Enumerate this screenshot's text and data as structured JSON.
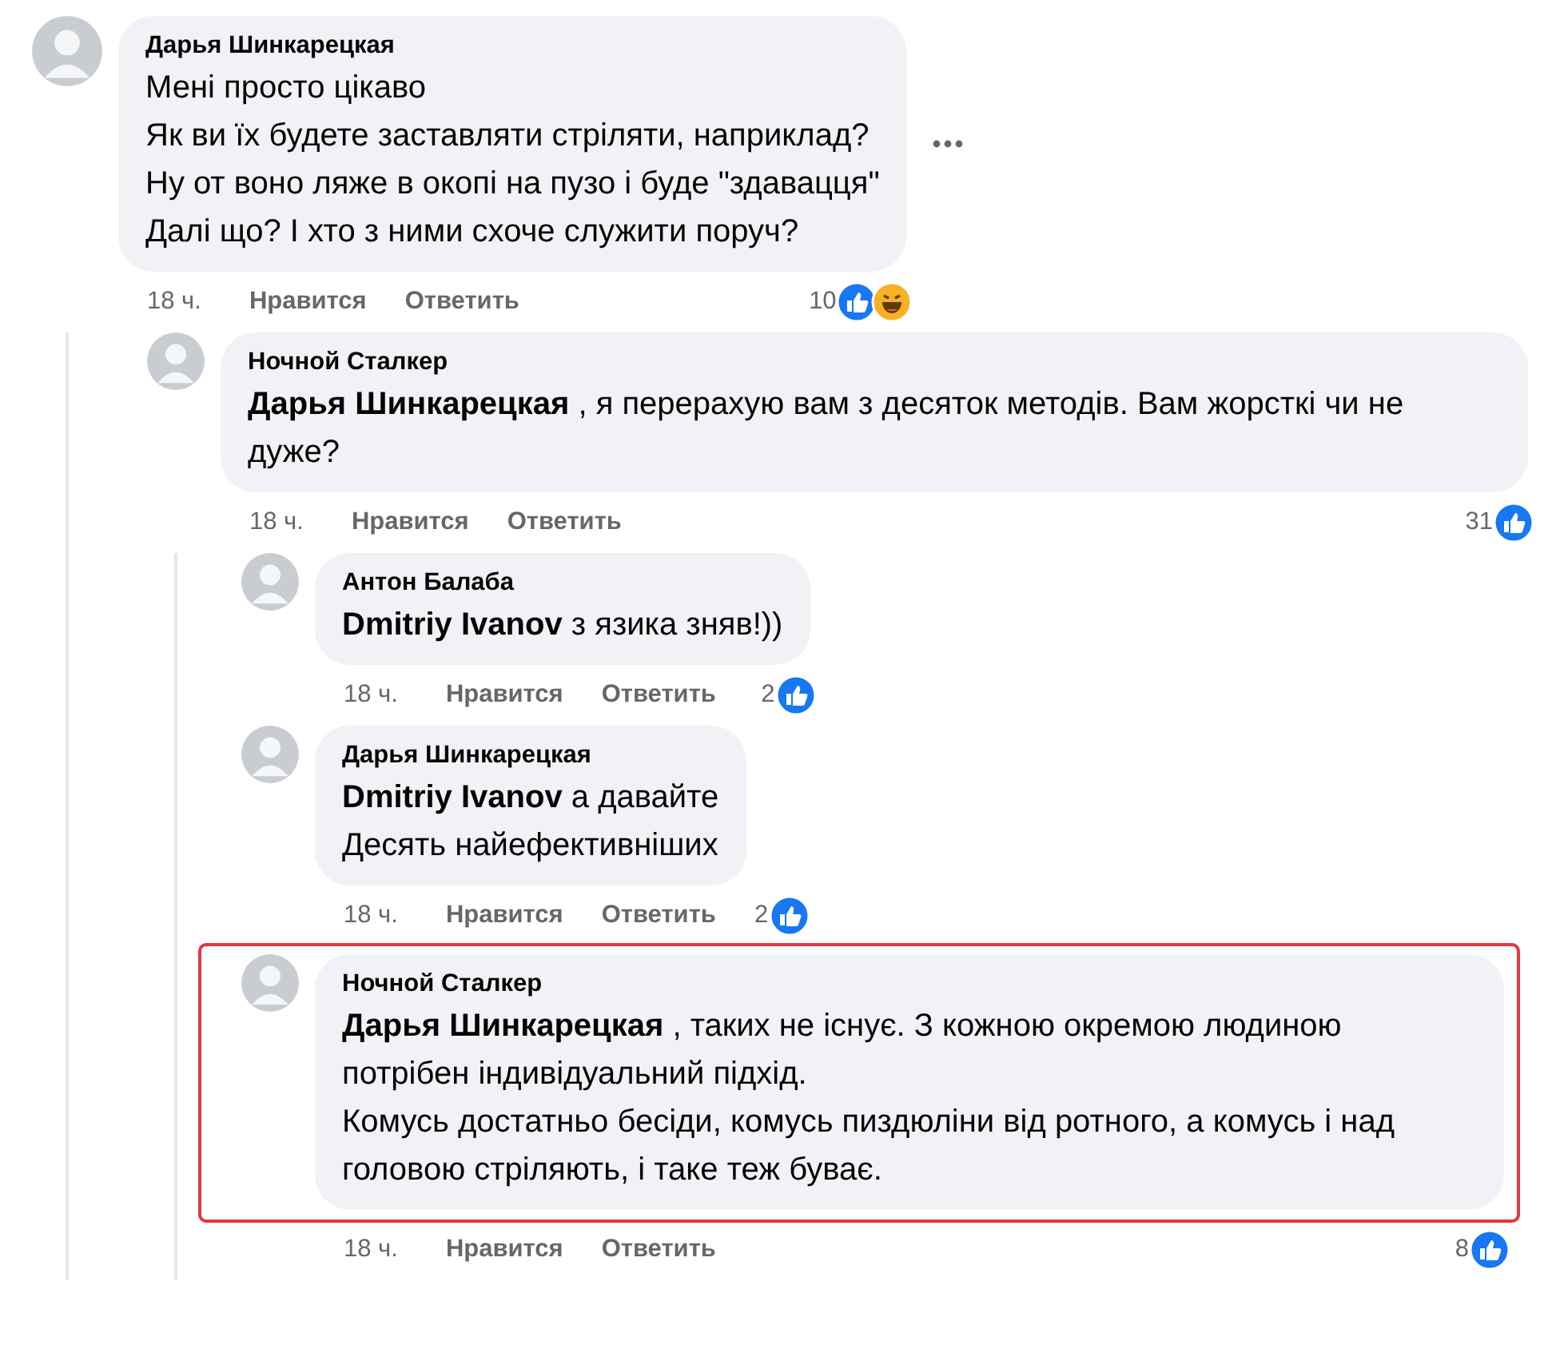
{
  "comments": [
    {
      "author": "Дарья Шинкарецкая",
      "lines": [
        "Мені просто цікаво",
        "Як ви їх будете заставляти стріляти, наприклад?",
        "Ну от воно ляже в окопі на пузо і буде \"здавацця\"",
        "Далі що? І хто з ними схоче служити поруч?"
      ],
      "menu_button": true,
      "highlighted": false,
      "time": "18 ч.",
      "like_label": "Нравится",
      "reply_label": "Ответить",
      "reaction_count": "10",
      "reactions": [
        {
          "kind": "like"
        },
        {
          "kind": "haha"
        }
      ],
      "children": [
        {
          "author": "Ночной Сталкер",
          "lines": [
            "**Дарья Шинкарецкая** , я перерахую вам з десяток методів. Вам жорсткі чи не дуже?"
          ],
          "menu_button": false,
          "highlighted": false,
          "time": "18 ч.",
          "like_label": "Нравится",
          "reply_label": "Ответить",
          "reaction_count": "31",
          "reactions": [
            {
              "kind": "like"
            }
          ],
          "children": [
            {
              "author": "Антон Балаба",
              "lines": [
                "**Dmitriy Ivanov** з язика зняв!))"
              ],
              "menu_button": false,
              "highlighted": false,
              "time": "18 ч.",
              "like_label": "Нравится",
              "reply_label": "Ответить",
              "reaction_count": "2",
              "reactions": [
                {
                  "kind": "like"
                }
              ]
            },
            {
              "author": "Дарья Шинкарецкая",
              "lines": [
                "**Dmitriy Ivanov** а давайте",
                "Десять найефективніших"
              ],
              "menu_button": false,
              "highlighted": false,
              "time": "18 ч.",
              "like_label": "Нравится",
              "reply_label": "Ответить",
              "reaction_count": "2",
              "reactions": [
                {
                  "kind": "like"
                }
              ]
            },
            {
              "author": "Ночной Сталкер",
              "lines": [
                "**Дарья Шинкарецкая** , таких не існує. З кожною окремою людиною потрібен індивідуальний підхід.",
                "Комусь достатньо бесіди, комусь пиздюліни від ротного, а комусь і над головою стріляють, і таке теж буває."
              ],
              "menu_button": false,
              "highlighted": true,
              "time": "18 ч.",
              "like_label": "Нравится",
              "reply_label": "Ответить",
              "reaction_count": "8",
              "reactions": [
                {
                  "kind": "like"
                }
              ]
            }
          ]
        }
      ]
    }
  ]
}
